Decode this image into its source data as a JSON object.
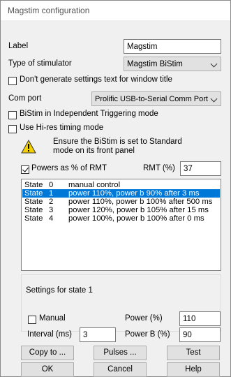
{
  "window": {
    "title": "Magstim configuration"
  },
  "label": {
    "caption": "Label",
    "value": "Magstim"
  },
  "stimulator": {
    "caption": "Type of stimulator",
    "value": "Magstim BiStim"
  },
  "dont_generate": {
    "label": "Don't generate settings text for window title",
    "checked": false
  },
  "com_port": {
    "caption": "Com port",
    "value": "Prolific USB-to-Serial Comm Port"
  },
  "bistim_independent": {
    "label": "BiStim in Independent Triggering mode",
    "checked": false
  },
  "hires": {
    "label": "Use Hi-res timing mode",
    "checked": false
  },
  "warning": {
    "line1": "Ensure the BiStim is set to Standard",
    "line2": "mode on its front panel",
    "icon": "warning-icon"
  },
  "powers_rmt": {
    "label": "Powers as % of RMT",
    "checked": true
  },
  "rmt": {
    "caption": "RMT (%)",
    "value": "37"
  },
  "states": [
    {
      "name": "State",
      "num": "0",
      "desc": "manual control",
      "selected": false
    },
    {
      "name": "State",
      "num": "1",
      "desc": "power 110%, power b 90% after 3 ms",
      "selected": true
    },
    {
      "name": "State",
      "num": "2",
      "desc": "power 110%, power b 100% after 500 ms",
      "selected": false
    },
    {
      "name": "State",
      "num": "3",
      "desc": "power 120%, power b 105% after 15 ms",
      "selected": false
    },
    {
      "name": "State",
      "num": "4",
      "desc": "power 100%, power b 100% after 0 ms",
      "selected": false
    }
  ],
  "settings": {
    "title": "Settings for state 1",
    "manual_label": "Manual",
    "manual_checked": false,
    "power_caption": "Power (%)",
    "power_value": "110",
    "interval_caption": "Interval (ms)",
    "interval_value": "3",
    "powerb_caption": "Power B (%)",
    "powerb_value": "90"
  },
  "buttons": {
    "copy_to": "Copy to ...",
    "pulses": "Pulses ...",
    "test": "Test",
    "ok": "OK",
    "cancel": "Cancel",
    "help": "Help"
  },
  "colors": {
    "selection": "#0078d7",
    "warning": "#f5d000"
  }
}
